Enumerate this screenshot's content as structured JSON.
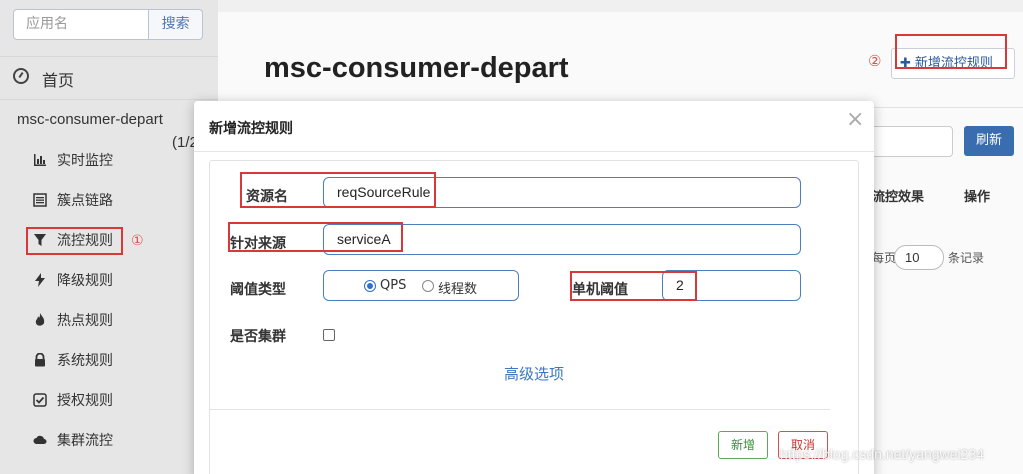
{
  "sidebar": {
    "search_placeholder": "应用名",
    "search_button": "搜索",
    "home_label": "首页",
    "app_name": "msc-consumer-depart",
    "app_count": "(1/2",
    "items": [
      {
        "label": "实时监控",
        "icon": "bar-chart-icon"
      },
      {
        "label": "簇点链路",
        "icon": "list-icon"
      },
      {
        "label": "流控规则",
        "icon": "filter-icon"
      },
      {
        "label": "降级规则",
        "icon": "bolt-icon"
      },
      {
        "label": "热点规则",
        "icon": "fire-icon"
      },
      {
        "label": "系统规则",
        "icon": "lock-icon"
      },
      {
        "label": "授权规则",
        "icon": "check-square-icon"
      },
      {
        "label": "集群流控",
        "icon": "cloud-icon"
      }
    ],
    "annotation": "①"
  },
  "content": {
    "page_title": "msc-consumer-depart",
    "add_rule_button": "新增流控规则",
    "annotation": "②",
    "refresh_button": "刷新",
    "columns": {
      "effect": "流控效果",
      "ops": "操作"
    },
    "pager": {
      "pre": "每页",
      "size": "10",
      "post": "条记录"
    }
  },
  "modal": {
    "title": "新增流控规则",
    "close": "×",
    "fields": {
      "resource_label": "资源名",
      "resource_value": "reqSourceRule",
      "source_label": "针对来源",
      "source_value": "serviceA",
      "threshold_type_label": "阈值类型",
      "options": [
        "QPS",
        "线程数"
      ],
      "selected_option": "QPS",
      "single_threshold_label": "单机阈值",
      "single_threshold_value": "2",
      "cluster_label": "是否集群",
      "cluster_checked": false
    },
    "advanced_link": "高级选项",
    "add_button": "新增",
    "cancel_button": "取消"
  },
  "watermark": "https://blog.csdn.net/yangwei234",
  "colors": {
    "accent": "#3b78c0",
    "annotation_red": "#d83838",
    "refresh": "#3a6db0"
  }
}
